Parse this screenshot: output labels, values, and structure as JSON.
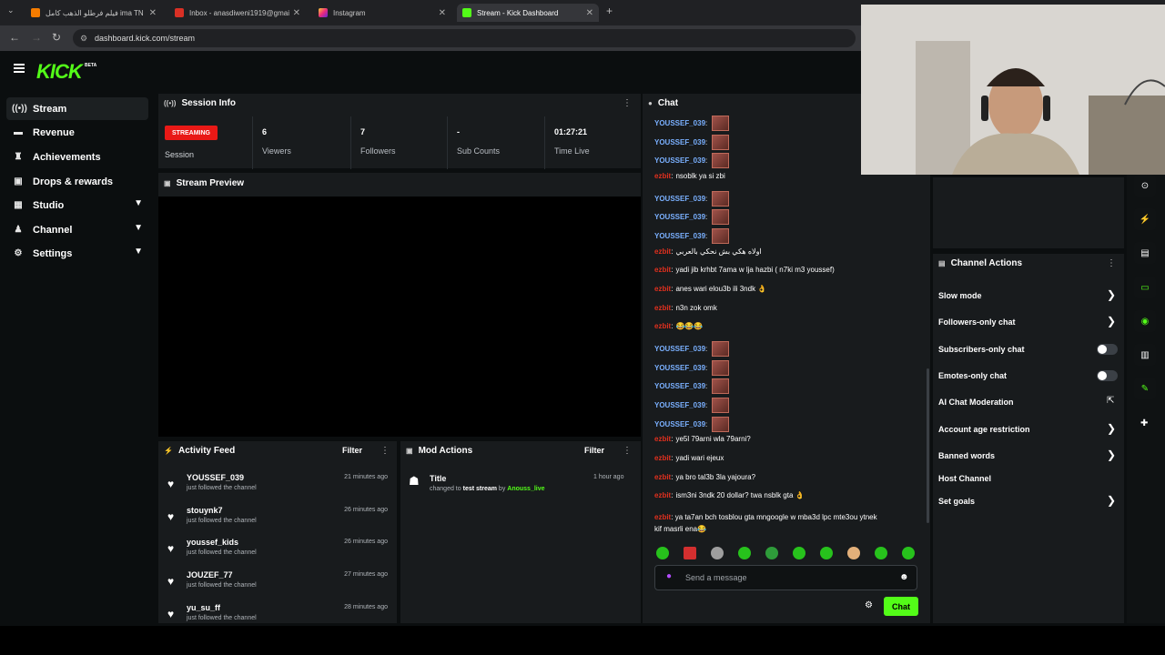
{
  "browser": {
    "tabs": [
      {
        "title": "فيلم فرطلو الذهب كامل ima TN"
      },
      {
        "title": "Inbox - anasdiweni1919@gmai"
      },
      {
        "title": "Instagram"
      },
      {
        "title": "Stream - Kick Dashboard"
      }
    ],
    "url": "dashboard.kick.com/stream"
  },
  "app": {
    "logo": "KICK",
    "logo_badge": "BETA"
  },
  "sidebar": {
    "items": [
      {
        "label": "Stream",
        "icon": "broadcast-icon"
      },
      {
        "label": "Revenue",
        "icon": "wallet-icon"
      },
      {
        "label": "Achievements",
        "icon": "trophy-icon"
      },
      {
        "label": "Drops & rewards",
        "icon": "gift-icon"
      },
      {
        "label": "Studio",
        "icon": "grid-icon"
      },
      {
        "label": "Channel",
        "icon": "users-icon"
      },
      {
        "label": "Settings",
        "icon": "gear-icon"
      }
    ]
  },
  "session": {
    "title": "Session Info",
    "badge": "STREAMING",
    "session_label": "Session",
    "stats": [
      {
        "value": "6",
        "label": "Viewers"
      },
      {
        "value": "7",
        "label": "Followers"
      },
      {
        "value": "-",
        "label": "Sub Counts"
      },
      {
        "value": "01:27:21",
        "label": "Time Live"
      }
    ]
  },
  "preview": {
    "title": "Stream Preview"
  },
  "activity": {
    "title": "Activity Feed",
    "filter": "Filter",
    "items": [
      {
        "user": "YOUSSEF_039",
        "action": "just followed the channel",
        "time": "21 minutes ago"
      },
      {
        "user": "stouynk7",
        "action": "just followed the channel",
        "time": "26 minutes ago"
      },
      {
        "user": "youssef_kids",
        "action": "just followed the channel",
        "time": "26 minutes ago"
      },
      {
        "user": "JOUZEF_77",
        "action": "just followed the channel",
        "time": "27 minutes ago"
      },
      {
        "user": "yu_su_ff",
        "action": "just followed the channel",
        "time": "28 minutes ago"
      }
    ]
  },
  "mod": {
    "title": "Mod Actions",
    "filter": "Filter",
    "item_title": "Title",
    "item_changed": "changed to",
    "item_value": "test stream",
    "item_by": "by",
    "item_user": "Anouss_live",
    "item_time": "1 hour ago"
  },
  "chat": {
    "title": "Chat",
    "messages": [
      {
        "user": "YOUSSEF_039",
        "text": "",
        "emote": true,
        "color": "u1"
      },
      {
        "user": "YOUSSEF_039",
        "text": "",
        "emote": true,
        "color": "u1"
      },
      {
        "user": "YOUSSEF_039",
        "text": "",
        "emote": true,
        "color": "u1"
      },
      {
        "user": "ezbit",
        "text": "nsoblk ya si zbi",
        "emote": false,
        "color": "u2"
      },
      {
        "user": "YOUSSEF_039",
        "text": "",
        "emote": true,
        "color": "u1"
      },
      {
        "user": "YOUSSEF_039",
        "text": "",
        "emote": true,
        "color": "u1"
      },
      {
        "user": "YOUSSEF_039",
        "text": "",
        "emote": true,
        "color": "u1"
      },
      {
        "user": "ezbit",
        "text": "اولاه هكي بش نحكي بالعربي",
        "emote": false,
        "color": "u2"
      },
      {
        "user": "ezbit",
        "text": "yadi jib krhbt 7ama w lja hazbi ( n7ki m3 youssef)",
        "emote": false,
        "color": "u2"
      },
      {
        "user": "ezbit",
        "text": "anes wari elou3b ili 3ndk 👌",
        "emote": false,
        "color": "u2"
      },
      {
        "user": "ezbit",
        "text": "n3n zok omk",
        "emote": false,
        "color": "u2"
      },
      {
        "user": "ezbit",
        "text": "😂😂😂",
        "emote": false,
        "color": "u2"
      },
      {
        "user": "YOUSSEF_039",
        "text": "",
        "emote": true,
        "color": "u1"
      },
      {
        "user": "YOUSSEF_039",
        "text": "",
        "emote": true,
        "color": "u1"
      },
      {
        "user": "YOUSSEF_039",
        "text": "",
        "emote": true,
        "color": "u1"
      },
      {
        "user": "YOUSSEF_039",
        "text": "",
        "emote": true,
        "color": "u1"
      },
      {
        "user": "YOUSSEF_039",
        "text": "",
        "emote": true,
        "color": "u1"
      },
      {
        "user": "ezbit",
        "text": "ye5l 79arni wla 79arni?",
        "emote": false,
        "color": "u2"
      },
      {
        "user": "ezbit",
        "text": "yadi wari ejeux",
        "emote": false,
        "color": "u2"
      },
      {
        "user": "ezbit",
        "text": "ya bro tal3b 3la yajoura?",
        "emote": false,
        "color": "u2"
      },
      {
        "user": "ezbit",
        "text": "ism3ni 3ndk 20 dollar? twa nsblk gta 👌",
        "emote": false,
        "color": "u2"
      }
    ],
    "last_message": {
      "user": "ezbit",
      "line1": "ya ta7an bch tosblou gta mngoogle w mba3d lpc mte3ou ytnek",
      "line2": "kif masrli ena😂"
    },
    "input_placeholder": "Send a message",
    "send_label": "Chat"
  },
  "channel_actions": {
    "title": "Channel Actions",
    "rows": [
      {
        "label": "Slow mode",
        "control": "arrow"
      },
      {
        "label": "Followers-only chat",
        "control": "arrow"
      },
      {
        "label": "Subscribers-only chat",
        "control": "toggle"
      },
      {
        "label": "Emotes-only chat",
        "control": "toggle"
      },
      {
        "label": "AI Chat Moderation",
        "control": "external"
      },
      {
        "label": "Account age restriction",
        "control": "arrow"
      },
      {
        "label": "Banned words",
        "control": "arrow"
      },
      {
        "label": "Host Channel",
        "control": "none"
      },
      {
        "label": "Set goals",
        "control": "arrow"
      }
    ]
  },
  "colors": {
    "accent": "#53fc18",
    "live": "#e91916"
  }
}
